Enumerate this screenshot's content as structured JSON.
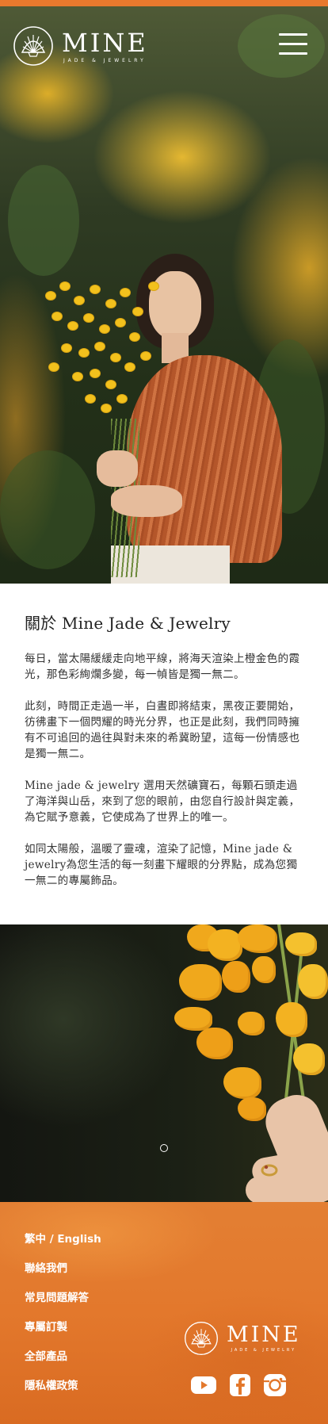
{
  "brand": {
    "name": "MINE",
    "tagline": "JADE & JEWELRY"
  },
  "header": {
    "menu_icon": "hamburger-menu-icon"
  },
  "about": {
    "title": "關於 Mine Jade & Jewelry",
    "paragraphs": [
      "每日，當太陽緩緩走向地平線，將海天渲染上橙金色的霞光，那色彩絢爛多變，每一幀皆是獨一無二。",
      "此刻，時間正走過一半，白晝即將結束，黑夜正要開始，彷彿畫下一個閃耀的時光分界，也正是此刻，我們同時擁有不可追回的過往與對未來的希冀盼望，這每一份情感也是獨一無二。",
      "Mine jade & jewelry 選用天然礦寶石，每顆石頭走過了海洋與山岳，來到了您的眼前，由您自行設計與定義，為它賦予意義，它使成為了世界上的唯一。",
      "如同太陽般，溫暖了靈魂，渲染了記憶，Mine jade & jewelry為您生活的每一刻畫下耀眼的分界點，成為您獨一無二的專屬飾品。"
    ]
  },
  "slider": {
    "dot_count": 1,
    "active_index": 0
  },
  "footer": {
    "links": [
      "繁中 / English",
      "聯絡我們",
      "常見問題解答",
      "專屬訂製",
      "全部產品",
      "隱私權政策"
    ],
    "social_icons": [
      "youtube-icon",
      "facebook-icon",
      "instagram-icon"
    ]
  },
  "colors": {
    "accent_orange": "#e8792d",
    "footer_orange": "#e37f33",
    "text_dark": "#2a2a2a"
  }
}
